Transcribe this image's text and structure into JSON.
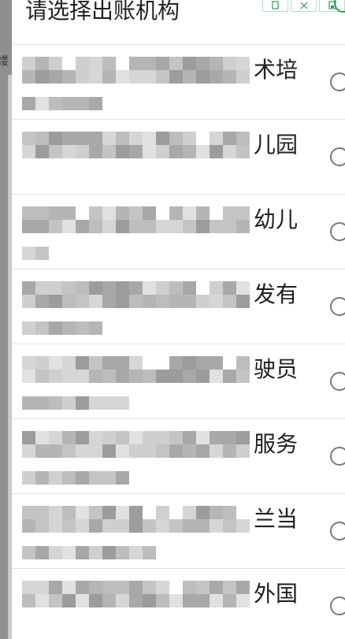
{
  "dialog": {
    "title": "请选择出账机构",
    "top_buttons": [
      {
        "icon": "copy-icon"
      },
      {
        "icon": "expand-icon"
      },
      {
        "icon": "save-icon"
      }
    ]
  },
  "background": {
    "edge_char": "缕"
  },
  "items": [
    {
      "label": "术培"
    },
    {
      "label": "儿园"
    },
    {
      "label": "幼儿"
    },
    {
      "label": "发有"
    },
    {
      "label": "驶员"
    },
    {
      "label": "服务"
    },
    {
      "label": "兰当"
    },
    {
      "label": "外国"
    }
  ],
  "colors": {
    "accent": "#2e9b57",
    "radio_border": "#7a7a7a"
  }
}
